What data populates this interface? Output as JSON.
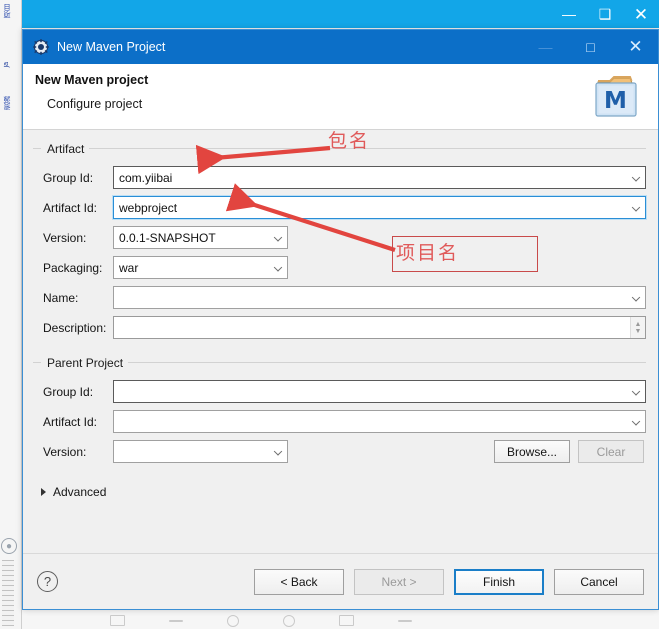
{
  "ide": {
    "window_controls": {
      "minimize": "—",
      "maximize": "❑",
      "close": "✕"
    },
    "left_tabs": [
      "项目",
      "ja",
      "资源"
    ]
  },
  "dialog": {
    "title": "New Maven Project",
    "title_icon": "maven-gear-icon",
    "window_controls": {
      "minimize": "—",
      "maximize": "□",
      "close": "✕"
    },
    "header": {
      "heading": "New Maven project",
      "subheading": "Configure project",
      "logo": "maven-logo-icon"
    },
    "artifact": {
      "group_title": "Artifact",
      "fields": [
        {
          "label": "Group Id:",
          "value": "com.yiibai",
          "type": "combo",
          "focused": false
        },
        {
          "label": "Artifact Id:",
          "value": "webproject",
          "type": "combo",
          "focused": true
        },
        {
          "label": "Version:",
          "value": "0.0.1-SNAPSHOT",
          "type": "combo-sm",
          "focused": false
        },
        {
          "label": "Packaging:",
          "value": "war",
          "type": "combo-sm",
          "focused": false
        },
        {
          "label": "Name:",
          "value": "",
          "type": "combo",
          "focused": false
        },
        {
          "label": "Description:",
          "value": "",
          "type": "textarea",
          "focused": false
        }
      ]
    },
    "parent": {
      "group_title": "Parent Project",
      "fields": [
        {
          "label": "Group Id:",
          "value": "",
          "type": "combo"
        },
        {
          "label": "Artifact Id:",
          "value": "",
          "type": "combo"
        },
        {
          "label": "Version:",
          "value": "",
          "type": "combo-sm"
        }
      ],
      "browse_label": "Browse...",
      "clear_label": "Clear",
      "clear_disabled": true
    },
    "advanced_label": "Advanced",
    "footer": {
      "help_label": "?",
      "buttons": [
        {
          "label": "< Back",
          "disabled": false,
          "default": false
        },
        {
          "label": "Next >",
          "disabled": true,
          "default": false
        },
        {
          "label": "Finish",
          "disabled": false,
          "default": true
        },
        {
          "label": "Cancel",
          "disabled": false,
          "default": false
        }
      ]
    }
  },
  "annotations": {
    "package_name": "包名",
    "project_name": "项目名",
    "color": "#e05a5a"
  },
  "colors": {
    "ide_titlebar": "#12a6e8",
    "dialog_titlebar": "#0c6fc8",
    "dialog_bg": "#f0f0f0",
    "focus_border": "#2a8ed6",
    "annotation_red": "#e05a5a"
  }
}
